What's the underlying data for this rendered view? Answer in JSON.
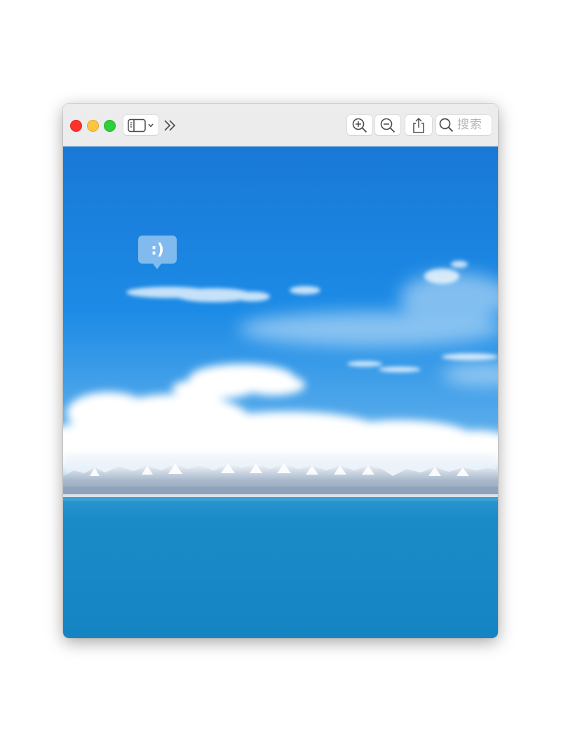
{
  "window": {
    "traffic_lights": {
      "close_color": "#fe312b",
      "minimize_color": "#fdc63f",
      "maximize_color": "#2dcf3b"
    }
  },
  "toolbar": {
    "sidebar_button_icon": "sidebar-icon",
    "sidebar_menu_icon": "chevron-down-icon",
    "overflow_icon": "chevron-double-right-icon",
    "zoom_in_icon": "zoom-in-icon",
    "zoom_out_icon": "zoom-out-icon",
    "share_icon": "share-icon",
    "search": {
      "icon": "search-icon",
      "placeholder": "搜索"
    }
  },
  "image": {
    "description_icon": "photo",
    "overlay_text": ":)"
  },
  "colors": {
    "titlebar": "#ececec",
    "sky_top": "#1a7fd8",
    "lake": "#1488c7"
  }
}
